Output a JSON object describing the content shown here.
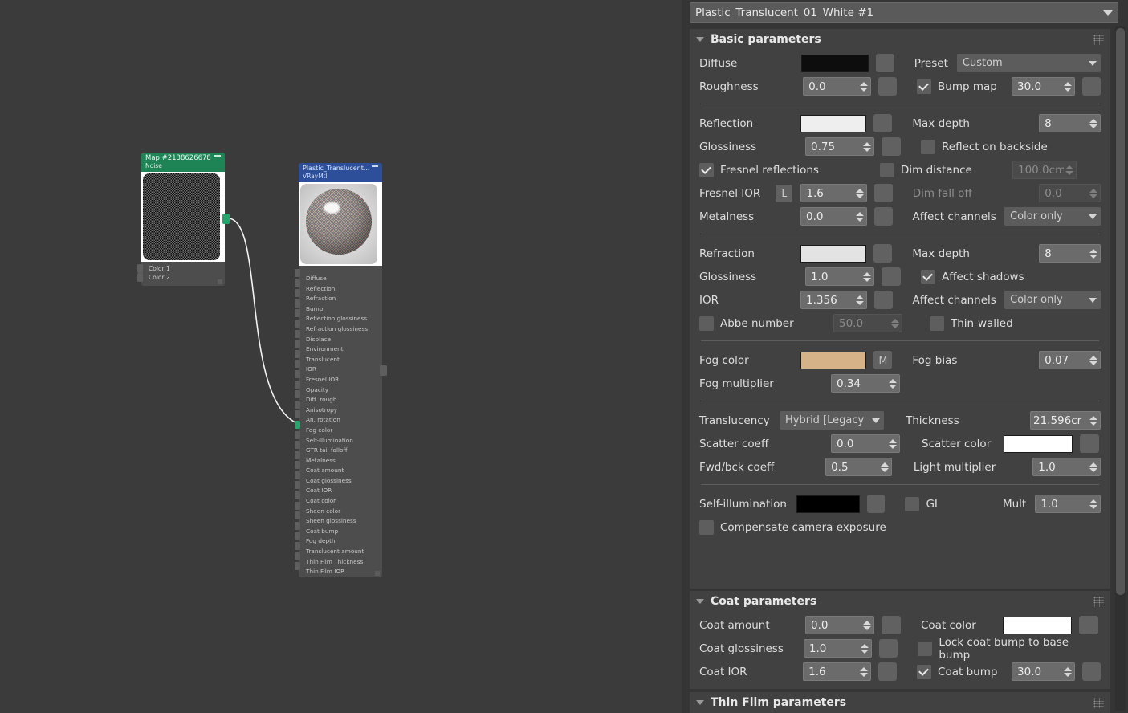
{
  "material_selector": {
    "value": "Plastic_Translucent_01_White #1",
    "icon": "chevron-down-icon"
  },
  "node_editor": {
    "map_node": {
      "title": "Map #2138626678",
      "subtitle": "Noise",
      "collapse_icon": "minus-icon",
      "inputs": [
        "Color 1",
        "Color 2"
      ],
      "output_socket_color": "#25a66c"
    },
    "material_node": {
      "title": "Plastic_Translucent...",
      "subtitle": "VRayMtl",
      "collapse_icon": "minus-icon",
      "inputs": [
        "Diffuse",
        "Reflection",
        "Refraction",
        "Bump",
        "Reflection glossiness",
        "Refraction glossiness",
        "Displace",
        "Environment",
        "Translucent",
        "IOR",
        "Fresnel IOR",
        "Opacity",
        "Diff. rough.",
        "Anisotropy",
        "An. rotation",
        "Fog color",
        "Self-illumination",
        "GTR tail falloff",
        "Metalness",
        "Coat amount",
        "Coat glossiness",
        "Coat IOR",
        "Coat color",
        "Sheen color",
        "Sheen glossiness",
        "Coat bump",
        "Fog depth",
        "Translucent amount",
        "Thin Film Thickness",
        "Thin Film IOR"
      ],
      "connected_input": "Fog color"
    },
    "wire_color": "#f2f2f2"
  },
  "rollouts": [
    {
      "title": "Basic parameters",
      "collapse_icon": "triangle-down-icon",
      "grip_icon": "grip-dots-icon"
    },
    {
      "title": "Coat parameters",
      "collapse_icon": "triangle-down-icon",
      "grip_icon": "grip-dots-icon"
    },
    {
      "title": "Thin Film parameters",
      "collapse_icon": "triangle-down-icon",
      "grip_icon": "grip-dots-icon"
    }
  ],
  "basic": {
    "diffuse_label": "Diffuse",
    "diffuse_color": "#0d0d0d",
    "preset_label": "Preset",
    "preset_value": "Custom",
    "roughness_label": "Roughness",
    "roughness_value": "0.0",
    "bump_map_label": "Bump map",
    "bump_map_checked": true,
    "bump_map_value": "30.0",
    "reflection_label": "Reflection",
    "reflection_color": "#eeeeee",
    "max_depth_label": "Max depth",
    "max_depth_value": "8",
    "refl_glossiness_label": "Glossiness",
    "refl_glossiness_value": "0.75",
    "reflect_backside_label": "Reflect on backside",
    "reflect_backside_checked": false,
    "fresnel_label": "Fresnel reflections",
    "fresnel_checked": true,
    "dim_distance_label": "Dim distance",
    "dim_distance_checked": false,
    "dim_distance_value": "100.0cm",
    "fresnel_ior_label": "Fresnel IOR",
    "fresnel_ior_lock": "L",
    "fresnel_ior_value": "1.6",
    "dim_falloff_label": "Dim fall off",
    "dim_falloff_value": "0.0",
    "metalness_label": "Metalness",
    "metalness_value": "0.0",
    "refl_affect_channels_label": "Affect channels",
    "refl_affect_channels_value": "Color only",
    "refraction_label": "Refraction",
    "refraction_color": "#e3e3e3",
    "refr_max_depth_label": "Max depth",
    "refr_max_depth_value": "8",
    "refr_glossiness_label": "Glossiness",
    "refr_glossiness_value": "1.0",
    "affect_shadows_label": "Affect shadows",
    "affect_shadows_checked": true,
    "ior_label": "IOR",
    "ior_value": "1.356",
    "refr_affect_channels_label": "Affect channels",
    "refr_affect_channels_value": "Color only",
    "abbe_label": "Abbe number",
    "abbe_checked": false,
    "abbe_value": "50.0",
    "thin_walled_label": "Thin-walled",
    "thin_walled_checked": false,
    "fog_color_label": "Fog color",
    "fog_color": "#d5b288",
    "fog_map_button": "M",
    "fog_bias_label": "Fog bias",
    "fog_bias_value": "0.07",
    "fog_multiplier_label": "Fog multiplier",
    "fog_multiplier_value": "0.34",
    "translucency_label": "Translucency",
    "translucency_value": "Hybrid [Legacy",
    "thickness_label": "Thickness",
    "thickness_value": "21.596cr",
    "scatter_coeff_label": "Scatter coeff",
    "scatter_coeff_value": "0.0",
    "scatter_color_label": "Scatter color",
    "scatter_color": "#ffffff",
    "fwd_bck_label": "Fwd/bck coeff",
    "fwd_bck_value": "0.5",
    "light_multiplier_label": "Light multiplier",
    "light_multiplier_value": "1.0",
    "self_illum_label": "Self-illumination",
    "self_illum_color": "#000000",
    "gi_label": "GI",
    "gi_checked": false,
    "mult_label": "Mult",
    "mult_value": "1.0",
    "compensate_label": "Compensate camera exposure",
    "compensate_checked": false
  },
  "coat": {
    "coat_amount_label": "Coat amount",
    "coat_amount_value": "0.0",
    "coat_color_label": "Coat color",
    "coat_color": "#ffffff",
    "coat_glossiness_label": "Coat glossiness",
    "coat_glossiness_value": "1.0",
    "lock_coat_bump_label": "Lock coat bump to base bump",
    "lock_coat_bump_checked": false,
    "coat_ior_label": "Coat IOR",
    "coat_ior_value": "1.6",
    "coat_bump_label": "Coat bump",
    "coat_bump_checked": true,
    "coat_bump_value": "30.0"
  }
}
